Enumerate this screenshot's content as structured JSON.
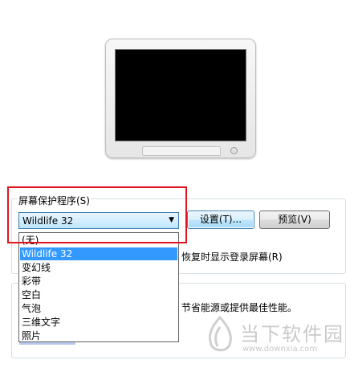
{
  "screensaver": {
    "label": "屏幕保护程序(S)",
    "selected": "Wildlife 32",
    "options": [
      "(无)",
      "Wildlife 32",
      "变幻线",
      "彩带",
      "空白",
      "气泡",
      "三维文字",
      "照片"
    ],
    "selected_index": 1,
    "settings_button": "设置(T)...",
    "preview_button": "预览(V)",
    "resume_text_partial": "恢复时显示登录屏幕(R)",
    "power_text_partial": "节省能源或提供最佳性能。"
  },
  "watermark": {
    "title": "当下软件园",
    "url": "www.downxia.com"
  },
  "colors": {
    "highlight": "#e0141e",
    "selection": "#3399ff"
  }
}
